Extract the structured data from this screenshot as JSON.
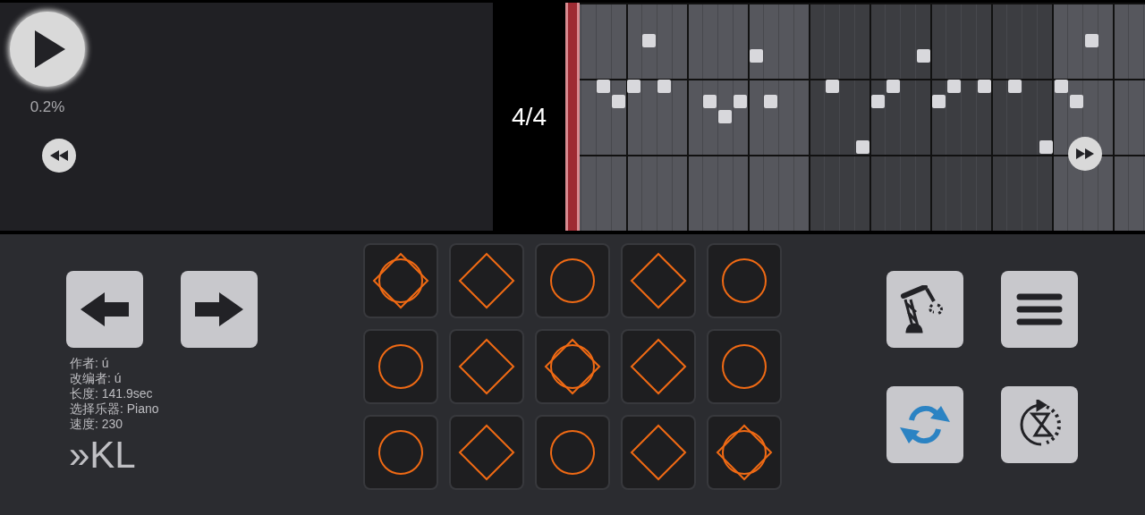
{
  "player": {
    "progress": "0.2%"
  },
  "time_signature": "4/4",
  "song_info": [
    "作者: ú",
    "改编者: ú",
    "长度: 141.9sec",
    "选择乐器: Piano",
    "速度: 230"
  ],
  "title": "»KL",
  "pads": [
    {
      "kind": "both"
    },
    {
      "kind": "diamond"
    },
    {
      "kind": "circle"
    },
    {
      "kind": "diamond"
    },
    {
      "kind": "circle"
    },
    {
      "kind": "circle"
    },
    {
      "kind": "diamond"
    },
    {
      "kind": "both"
    },
    {
      "kind": "diamond"
    },
    {
      "kind": "circle"
    },
    {
      "kind": "circle"
    },
    {
      "kind": "diamond"
    },
    {
      "kind": "circle"
    },
    {
      "kind": "diamond"
    },
    {
      "kind": "both"
    }
  ]
}
